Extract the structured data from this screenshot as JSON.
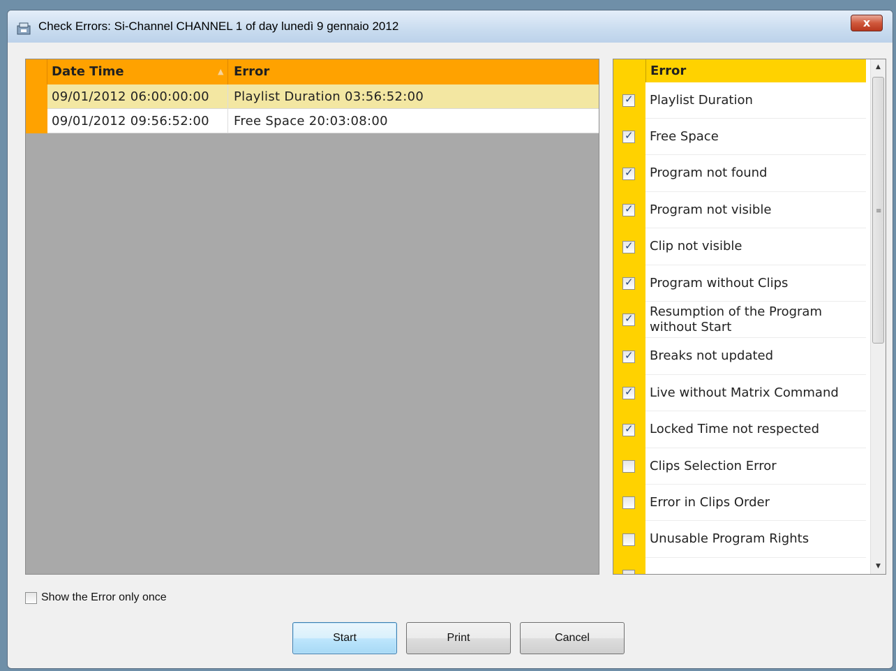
{
  "window": {
    "title": "Check Errors: Si-Channel CHANNEL 1 of day lunedì 9 gennaio 2012",
    "close_label": "x"
  },
  "grid": {
    "columns": {
      "datetime": "Date Time",
      "error": "Error"
    },
    "sort_indicator": "▲",
    "rows": [
      {
        "datetime": "09/01/2012   06:00:00:00",
        "error": "Playlist Duration 03:56:52:00",
        "selected": true
      },
      {
        "datetime": "09/01/2012   09:56:52:00",
        "error": "Free Space 20:03:08:00",
        "selected": false
      }
    ]
  },
  "checklist": {
    "header": "Error",
    "items": [
      {
        "label": "Playlist Duration",
        "checked": true
      },
      {
        "label": "Free Space",
        "checked": true
      },
      {
        "label": "Program not found",
        "checked": true
      },
      {
        "label": "Program not visible",
        "checked": true
      },
      {
        "label": "Clip not visible",
        "checked": true
      },
      {
        "label": "Program without Clips",
        "checked": true
      },
      {
        "label": "Resumption of the Program without Start",
        "checked": true
      },
      {
        "label": "Breaks not updated",
        "checked": true
      },
      {
        "label": "Live without Matrix Command",
        "checked": true
      },
      {
        "label": "Locked Time not respected",
        "checked": true
      },
      {
        "label": "Clips Selection Error",
        "checked": false
      },
      {
        "label": "Error in Clips Order",
        "checked": false
      },
      {
        "label": "Unusable Program Rights",
        "checked": false
      }
    ],
    "scrollbar": {
      "up": "▲",
      "down": "▼",
      "grip": "≡"
    }
  },
  "options": {
    "show_once_label": "Show the Error only once",
    "show_once_checked": false
  },
  "buttons": {
    "start": "Start",
    "print": "Print",
    "cancel": "Cancel"
  },
  "colors": {
    "grid_header": "#ffa200",
    "checklist_header": "#ffd200",
    "selected_row": "#f3e7a2"
  }
}
